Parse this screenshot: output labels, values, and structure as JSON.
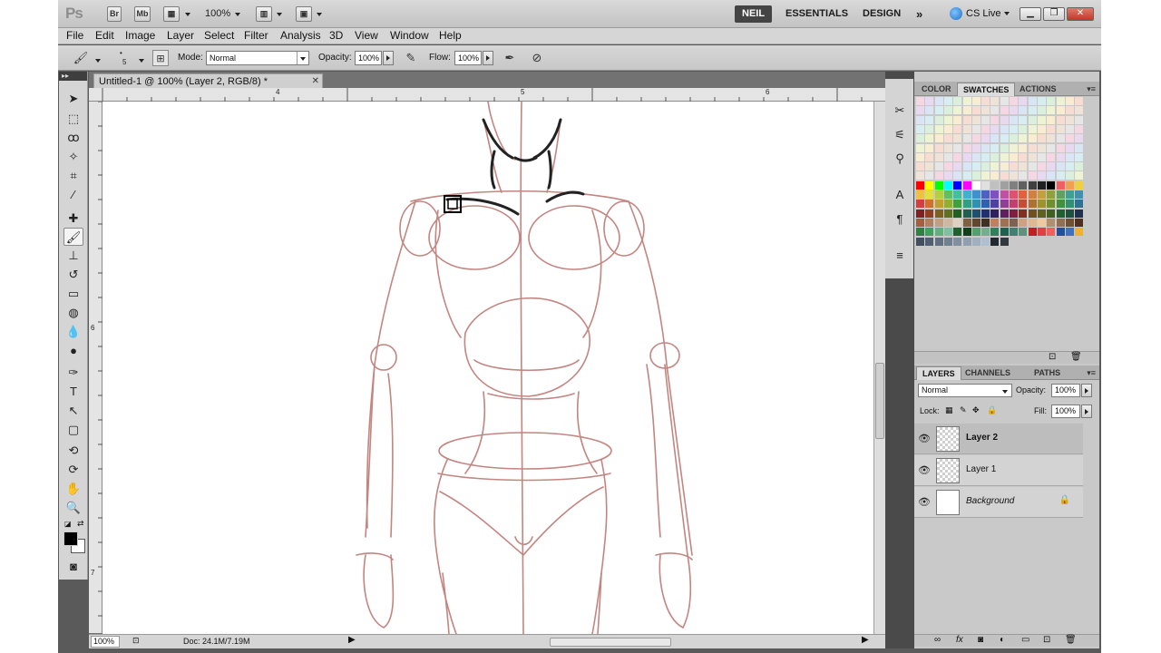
{
  "appbar": {
    "logo": "Ps",
    "bridge_label": "Br",
    "minibridge_label": "Mb",
    "zoom_value": "100%",
    "workspaces": [
      "NEIL",
      "ESSENTIALS",
      "DESIGN"
    ],
    "more_label": "»",
    "cslive_label": "CS Live"
  },
  "menubar": [
    "File",
    "Edit",
    "Image",
    "Layer",
    "Select",
    "Filter",
    "Analysis",
    "3D",
    "View",
    "Window",
    "Help"
  ],
  "options": {
    "brush_size": "5",
    "mode_label": "Mode:",
    "mode_value": "Normal",
    "opacity_label": "Opacity:",
    "opacity_value": "100%",
    "flow_label": "Flow:",
    "flow_value": "100%"
  },
  "document": {
    "tab_title": "Untitled-1 @ 100% (Layer 2, RGB/8) *",
    "ruler_h_labels": [
      "4",
      "5",
      "6"
    ],
    "ruler_v_labels": [
      "6",
      "7"
    ],
    "zoom": "100%",
    "doc_info": "Doc: 24.1M/7.19M"
  },
  "swatch_panel": {
    "tabs": [
      "COLOR",
      "SWATCHES",
      "ACTIONS"
    ],
    "active_tab": "SWATCHES"
  },
  "layers_panel": {
    "tabs": [
      "LAYERS",
      "CHANNELS",
      "PATHS"
    ],
    "active_tab": "LAYERS",
    "blend_mode": "Normal",
    "opacity_label": "Opacity:",
    "opacity_value": "100%",
    "lock_label": "Lock:",
    "fill_label": "Fill:",
    "fill_value": "100%",
    "layers": [
      {
        "name": "Layer 2",
        "selected": true
      },
      {
        "name": "Layer 1",
        "selected": false
      },
      {
        "name": "Background",
        "selected": false
      }
    ]
  },
  "colors": {
    "sketch_red": "#b9706a",
    "ink_black": "#222222",
    "foreground": "#000000",
    "background": "#ffffff"
  }
}
